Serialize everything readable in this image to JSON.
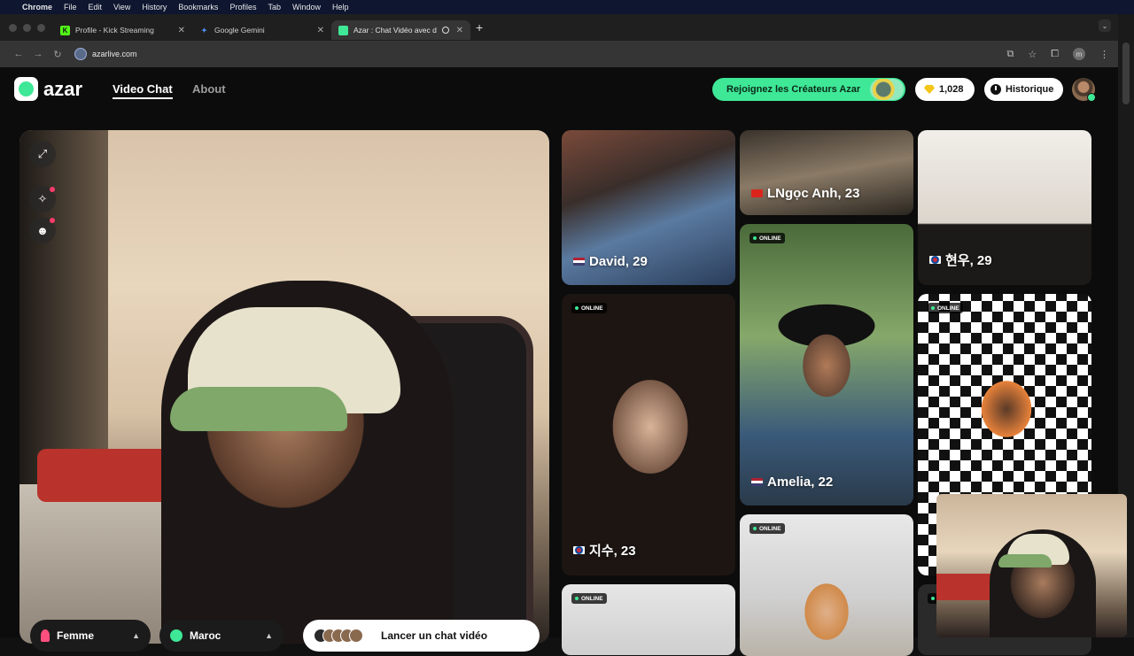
{
  "menubar": {
    "app": "Chrome",
    "items": [
      "File",
      "Edit",
      "View",
      "History",
      "Bookmarks",
      "Profiles",
      "Tab",
      "Window",
      "Help"
    ]
  },
  "tabs": [
    {
      "label": "Profile - Kick Streaming",
      "icon": "K",
      "icon_color": "#53fc18"
    },
    {
      "label": "Google Gemini",
      "icon": "✦",
      "icon_color": "#4f8ff7"
    },
    {
      "label": "Azar : Chat Vidéo avec de",
      "icon": "◆",
      "icon_color": "#3ee896"
    }
  ],
  "address": {
    "url": "azarlive.com"
  },
  "header": {
    "logo_text": "azar",
    "nav": [
      {
        "label": "Video Chat"
      },
      {
        "label": "About"
      }
    ],
    "creator_cta": "Rejoignez les Créateurs Azar",
    "gems": "1,028",
    "history": "Historique"
  },
  "controls": {
    "gender": "Femme",
    "country": "Maroc",
    "start": "Lancer un chat vidéo"
  },
  "cards": [
    {
      "name": "David, 29",
      "online": false,
      "flag": "US"
    },
    {
      "name": "LNgọc Anh, 23",
      "online": false,
      "flag": "VN"
    },
    {
      "name": "현우, 29",
      "online": false,
      "flag": "KR"
    },
    {
      "name": "지수, 23",
      "online": true,
      "flag": "KR"
    },
    {
      "name": "Amelia, 22",
      "online": true,
      "flag": "US"
    },
    {
      "name": "",
      "online": true,
      "flag": ""
    },
    {
      "name": "",
      "online": true,
      "flag": ""
    },
    {
      "name": "",
      "online": true,
      "flag": ""
    }
  ],
  "online_label": "ONLINE",
  "colors": {
    "brand_green": "#3ee896",
    "background": "#0c0c0c"
  }
}
